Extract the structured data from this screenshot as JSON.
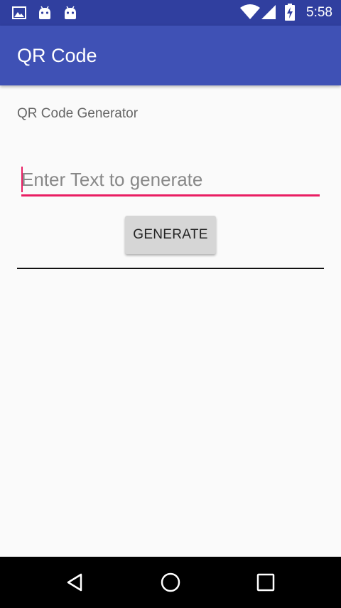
{
  "status_bar": {
    "time": "5:58",
    "left_icons": [
      "image-icon",
      "android-icon",
      "android-icon"
    ],
    "right_icons": [
      "wifi-icon",
      "cell-signal-icon",
      "battery-charging-icon"
    ]
  },
  "app_bar": {
    "title": "QR Code"
  },
  "content": {
    "subtitle": "QR Code Generator",
    "text_input": {
      "value": "",
      "placeholder": "Enter Text to generate"
    },
    "generate_button_label": "GENERATE"
  },
  "nav_bar": {
    "buttons": [
      "back-icon",
      "home-icon",
      "recents-icon"
    ]
  },
  "colors": {
    "status_bar": "#303f9f",
    "app_bar": "#3f51b5",
    "accent": "#e91e63",
    "background": "#fafafa"
  }
}
